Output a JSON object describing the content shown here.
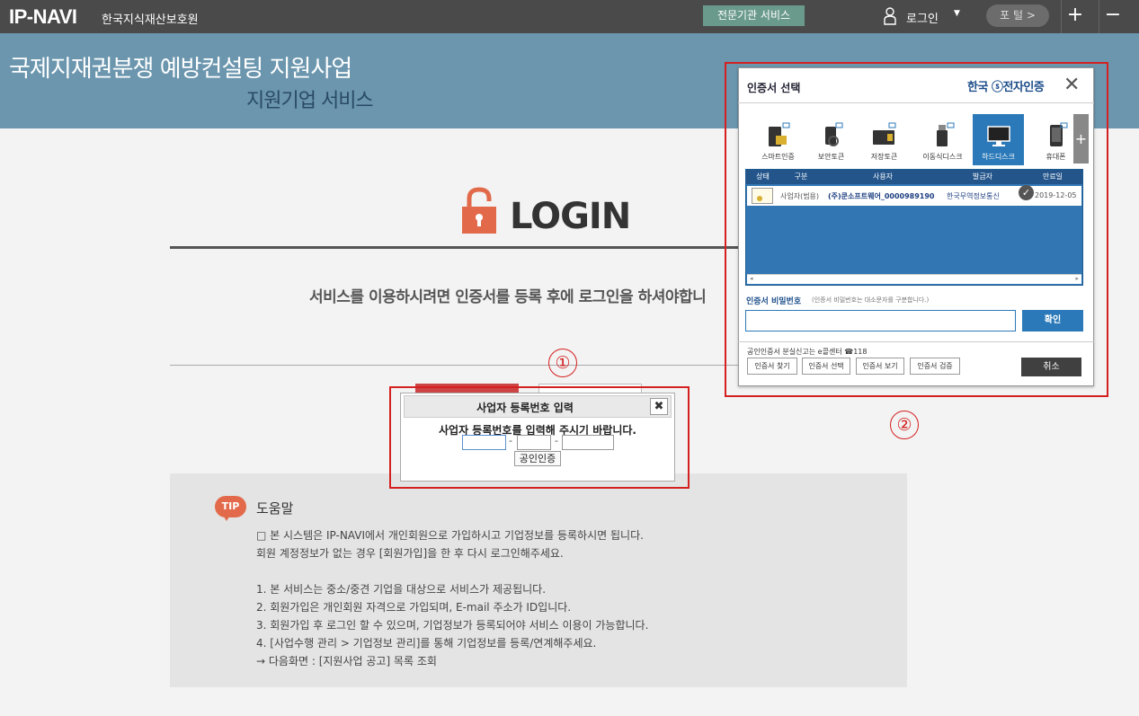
{
  "topbar": {
    "logo": "IP-NAVI",
    "org": "한국지식재산보호원",
    "expert_button": "전문기관 서비스",
    "login_label": "로그인",
    "portal_button": "포 털 >",
    "plus": "+",
    "minus": "−"
  },
  "banner": {
    "title": "국제지재권분쟁 예방컨설팅 지원사업",
    "subtitle": "지원기업 서비스"
  },
  "login": {
    "title": "LOGIN",
    "description": "서비스를 이용하시려면 인증서를 등록 후에 로그인을 하셔야합니"
  },
  "annotations": {
    "one": "①",
    "two": "②"
  },
  "biz_dialog": {
    "title": "사업자 등록번호 입력",
    "close": "✖",
    "message": "사업자 등록번호를 입력해 주시기 바랍니다.",
    "dash": "-",
    "button": "공인인증"
  },
  "cert_dialog": {
    "title": "인증서 선택",
    "brand": "한국 ⓢ전자인증",
    "media": [
      {
        "label": "스마트인증"
      },
      {
        "label": "보안토큰"
      },
      {
        "label": "저장토큰"
      },
      {
        "label": "이동식디스크"
      },
      {
        "label": "하드디스크"
      },
      {
        "label": "휴대폰"
      }
    ],
    "more": "+",
    "columns": [
      "상태",
      "구분",
      "사용자",
      "발급자",
      "만료일"
    ],
    "row": {
      "type": "사업자(범용)",
      "user": "(주)쿤소프트웨어_0000989190",
      "issuer": "한국무역정보통신",
      "expiry": "2019-12-05"
    },
    "password_label": "인증서 비밀번호",
    "password_hint": "(인증서 비밀번호는 대소문자를 구분합니다.)",
    "confirm": "확인",
    "loss_note": "공인인증서 분실신고는 e콜센터 ☎118",
    "buttons": [
      "인증서 찾기",
      "인증서 선택",
      "인증서 보기",
      "인증서 검증"
    ],
    "cancel": "취소"
  },
  "help": {
    "badge": "TIP",
    "title": "도움말",
    "lines": [
      "□ 본 시스템은 IP-NAVI에서 개인회원으로 가입하시고 기업정보를 등록하시면 됩니다.",
      "회원 계정정보가 없는 경우 [회원가입]을 한 후 다시 로그인해주세요.",
      "1. 본 서비스는 중소/중견 기업을 대상으로 서비스가 제공됩니다.",
      "2. 회원가입은 개인회원 자격으로 가입되며, E-mail 주소가 ID입니다.",
      "3. 회원가입 후 로그인 할 수 있으며, 기업정보가 등록되어야 서비스 이용이 가능합니다.",
      "4. [사업수행 관리 > 기업정보 관리]를 통해 기업정보를 등록/연계해주세요.",
      "→ 다음화면 : [지원사업 공고] 목록 조회"
    ]
  }
}
